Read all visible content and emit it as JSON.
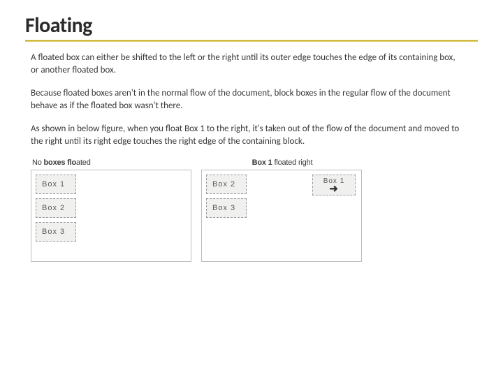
{
  "title": "Floating",
  "paragraphs": {
    "p1": "A floated box can either be shifted to the left or the right until its outer edge touches the edge of its containing box, or another floated box.",
    "p2": "Because floated boxes aren't in the normal flow of the document, block boxes in the regular flow of the document behave as if the floated box wasn't there.",
    "p3": "As shown in below figure, when you float Box 1 to the right, it's taken out of the flow of the document and moved to the right until its right edge touches the right edge of the containing block."
  },
  "figure": {
    "left": {
      "caption_prefix": "No ",
      "caption_bold": "boxes flo",
      "caption_suffix": "ated",
      "boxes": [
        "Box 1",
        "Box 2",
        "Box 3"
      ]
    },
    "right": {
      "caption_bold": "Box 1",
      "caption_suffix": " floated right",
      "stack_boxes": [
        "Box 2",
        "Box 3"
      ],
      "floated_box": "Box 1"
    }
  }
}
